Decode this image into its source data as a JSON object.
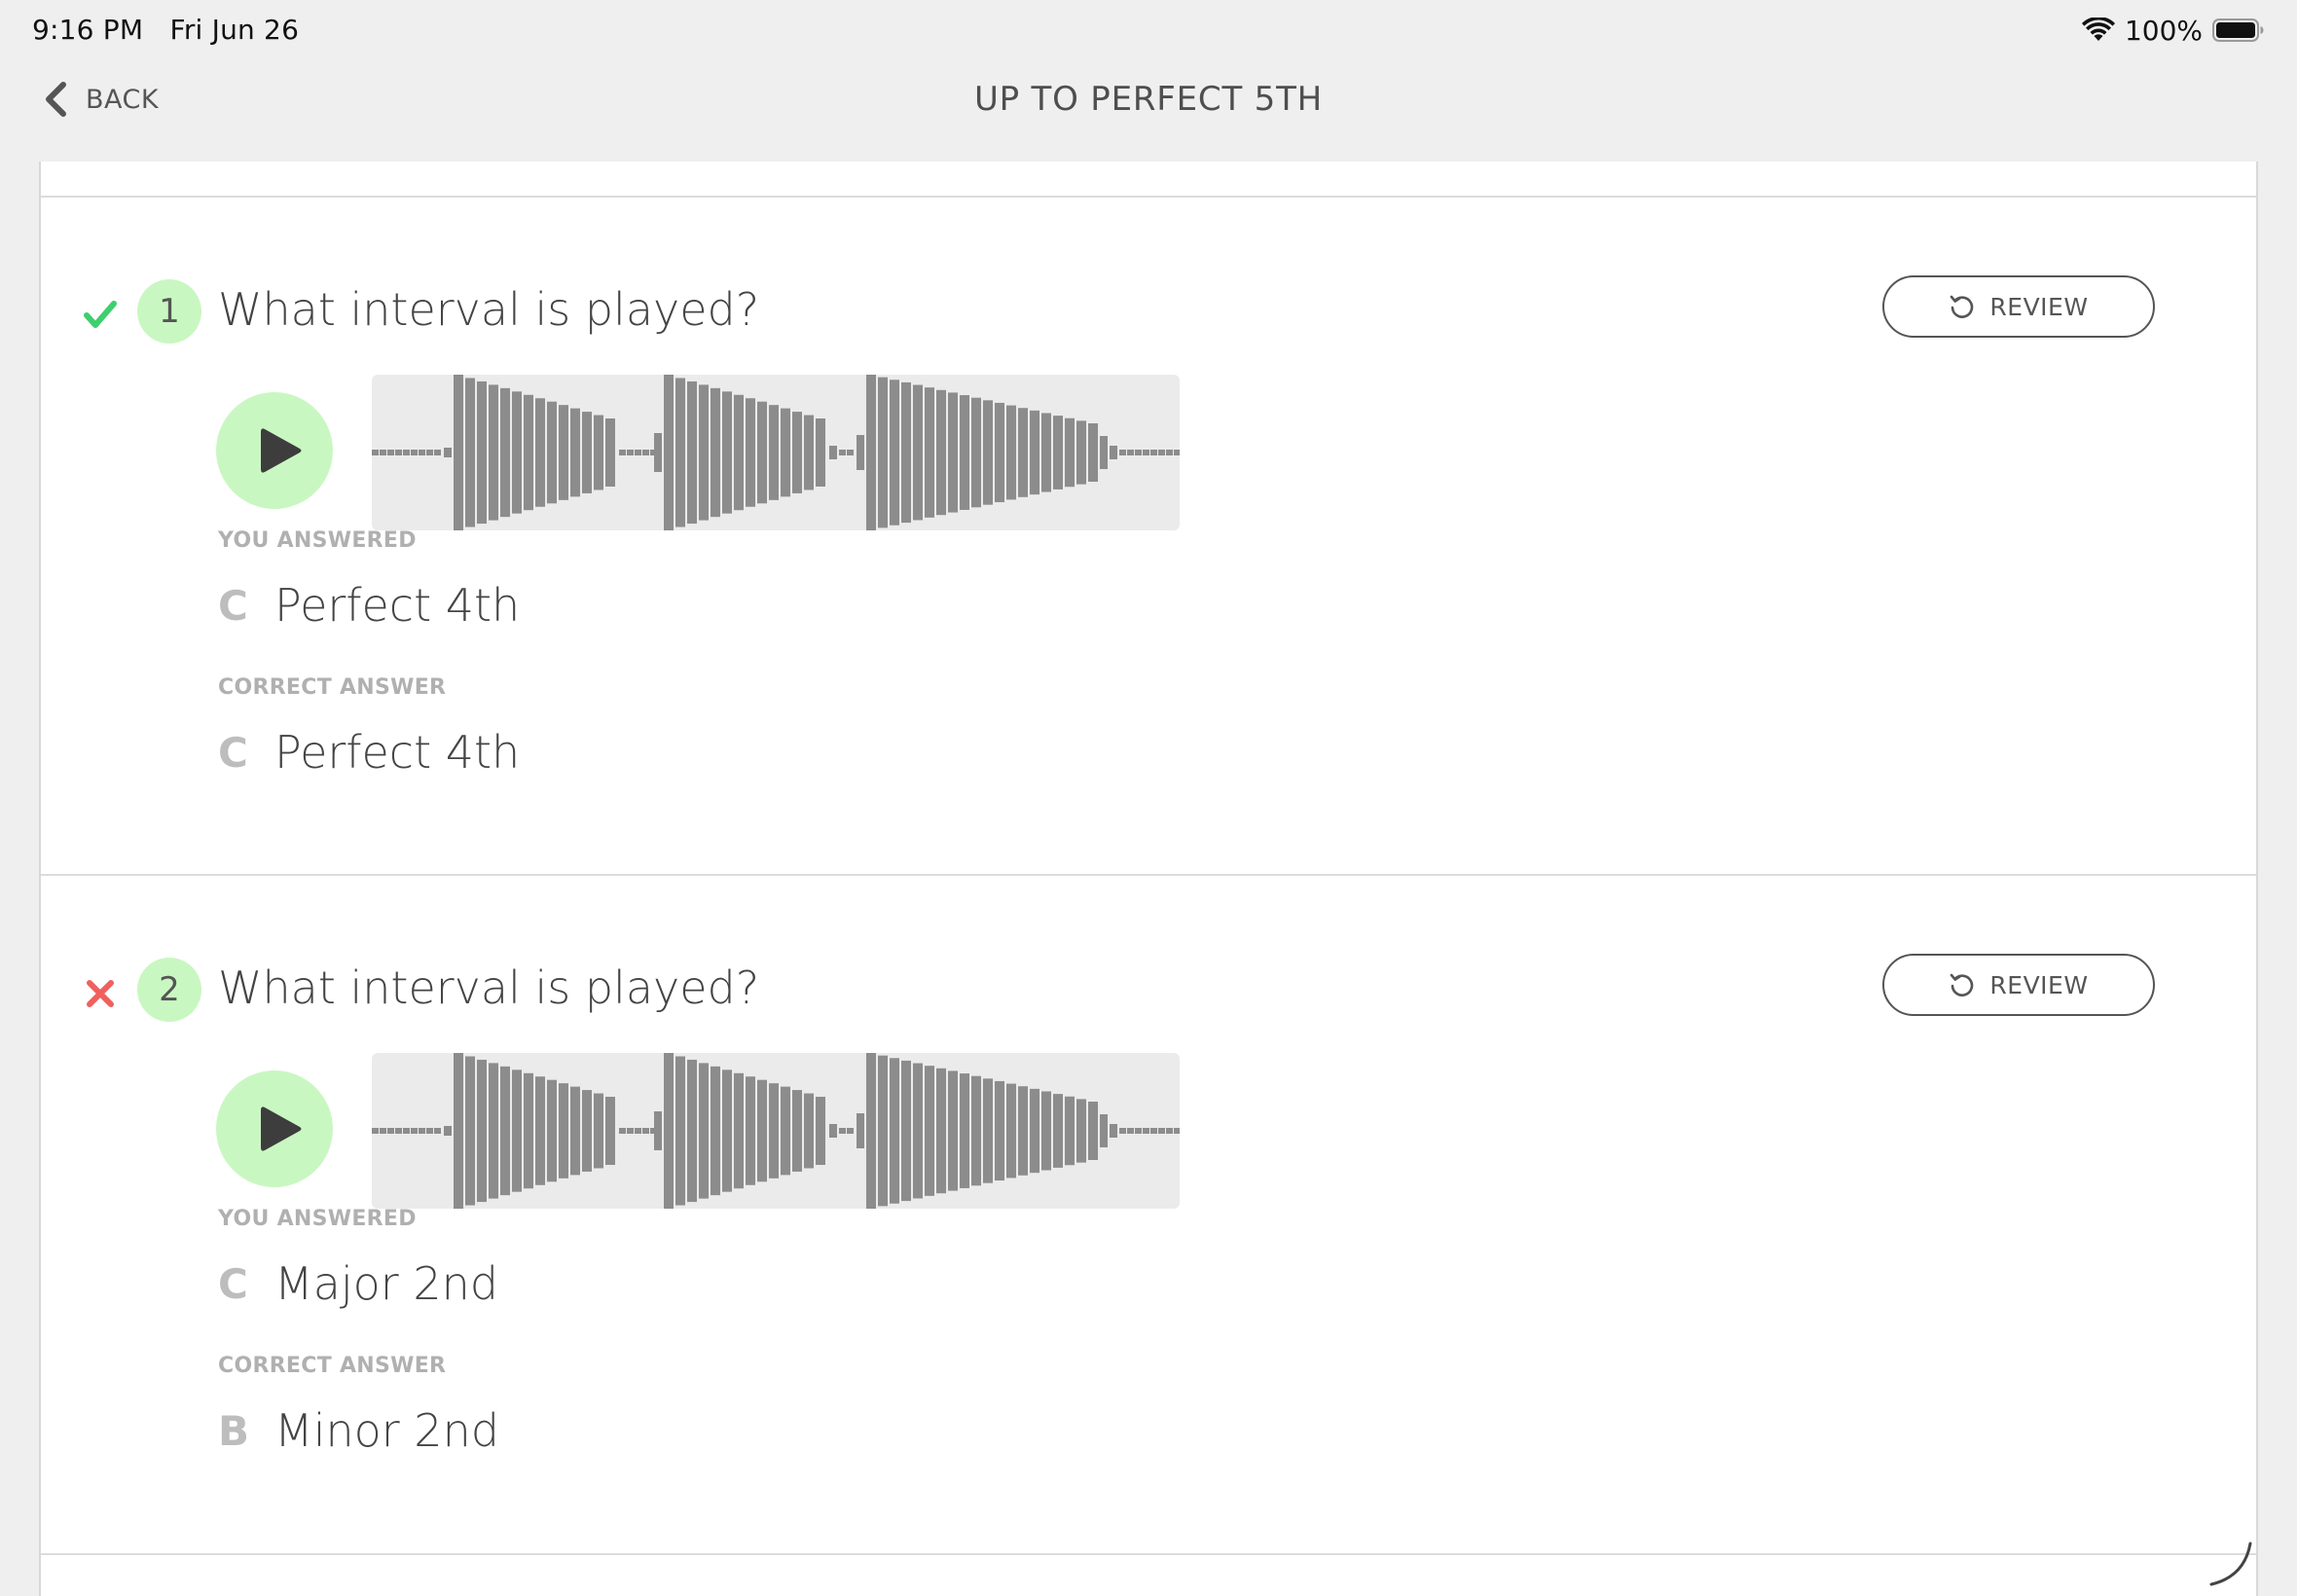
{
  "status_bar": {
    "time": "9:16 PM",
    "date": "Fri Jun 26",
    "battery": "100%"
  },
  "nav": {
    "back_label": "BACK",
    "title": "UP TO PERFECT 5TH"
  },
  "questions": [
    {
      "number": "1",
      "result": "correct",
      "text": "What interval is played?",
      "review_label": "REVIEW",
      "you_answered_label": "YOU ANSWERED",
      "you_answered_letter": "C",
      "you_answered_text": "Perfect 4th",
      "correct_answer_label": "CORRECT ANSWER",
      "correct_letter": "C",
      "correct_text": "Perfect 4th"
    },
    {
      "number": "2",
      "result": "incorrect",
      "text": "What interval is played?",
      "review_label": "REVIEW",
      "you_answered_label": "YOU ANSWERED",
      "you_answered_letter": "C",
      "you_answered_text": "Major 2nd",
      "correct_answer_label": "CORRECT ANSWER",
      "correct_letter": "B",
      "correct_text": "Minor 2nd"
    }
  ],
  "colors": {
    "correct": "#3ecf6e",
    "incorrect": "#f0605d",
    "badge": "#c9f7c1",
    "waveform_bar": "#8c8c8c"
  }
}
